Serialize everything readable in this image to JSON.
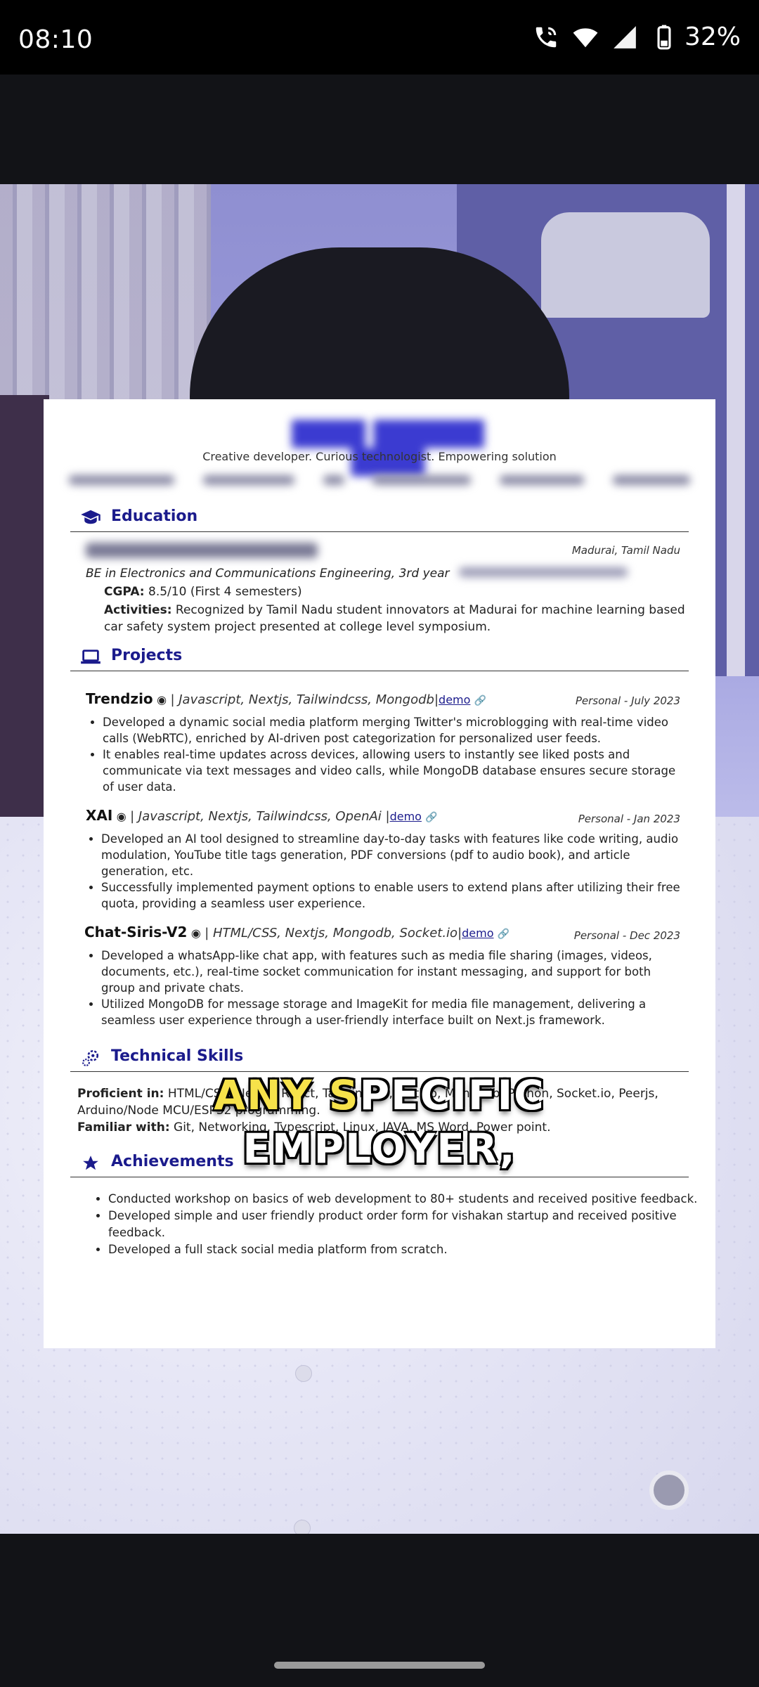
{
  "status_bar": {
    "time": "08:10",
    "battery_percent": "32%",
    "icons": [
      "wifi-call-icon",
      "wifi-icon",
      "cellular-signal-icon",
      "battery-icon"
    ]
  },
  "resume": {
    "tagline": "Creative developer. Curious technologist. Empowering solution",
    "sections": {
      "education": "Education",
      "projects": "Projects",
      "skills": "Technical Skills",
      "achievements": "Achievements"
    },
    "education": {
      "location": "Madurai, Tamil Nadu",
      "degree": "BE in Electronics and Communications Engineering, 3rd year",
      "cgpa_label": "CGPA:",
      "cgpa_value": "8.5/10 (First 4 semesters)",
      "activities_label": "Activities:",
      "activities_value": "Recognized by Tamil Nadu student innovators at Madurai for machine learning based car safety system project presented at college level symposium."
    },
    "projects": [
      {
        "title": "Trendzio",
        "tech": "| Javascript, Nextjs, Tailwindcss, Mongodb|",
        "demo": "demo",
        "meta": "Personal - July 2023",
        "bullets": [
          "Developed a dynamic social media platform merging Twitter's microblogging with real-time video calls (WebRTC), enriched by AI-driven post categorization for personalized user feeds.",
          "It enables real-time updates across devices, allowing users to instantly see liked posts and communicate via text messages and video calls, while MongoDB database ensures secure storage of user data."
        ]
      },
      {
        "title": "XAI",
        "tech": "| Javascript, Nextjs, Tailwindcss, OpenAi |",
        "demo": "demo",
        "meta": "Personal - Jan 2023",
        "bullets": [
          "Developed an AI tool designed to streamline day-to-day tasks with features like code writing, audio modulation, YouTube title tags generation, PDF conversions (pdf to audio book), and article generation, etc.",
          "Successfully implemented payment options to enable users to extend plans after utilizing their free quota, providing a seamless user experience."
        ]
      },
      {
        "title": "Chat-Siris-V2",
        "tech": "| HTML/CSS, Nextjs, Mongodb, Socket.io|",
        "demo": "demo",
        "meta": "Personal - Dec 2023",
        "bullets": [
          "Developed a whatsApp-like chat app, with features such as media file sharing (images, videos, documents, etc.), real-time socket communication for instant messaging, and support for both group and private chats.",
          "Utilized MongoDB for message storage and ImageKit for media file management, delivering a seamless user experience through a user-friendly interface built on Next.js framework."
        ]
      }
    ],
    "skills": {
      "proficient_label": "Proficient in:",
      "proficient_value": "HTML/CSS, Nextjs, React, Tailwindcss, Matlab, Mongodb, Python, Socket.io, Peerjs, Arduino/Node MCU/ESP32 programming.",
      "familiar_label": "Familiar with:",
      "familiar_value": "Git, Networking, Typescript, Linux, JAVA, MS Word, Power point."
    },
    "achievements": [
      "Conducted workshop on basics of web development to 80+ students and received positive feedback.",
      "Developed simple and user friendly product order form for vishakan startup and received positive feedback.",
      "Developed a full stack social media platform from scratch."
    ]
  },
  "caption": {
    "line1_highlight": "ANY S",
    "line1_rest": "PECIFIC",
    "line2": "EMPLOYER,"
  }
}
